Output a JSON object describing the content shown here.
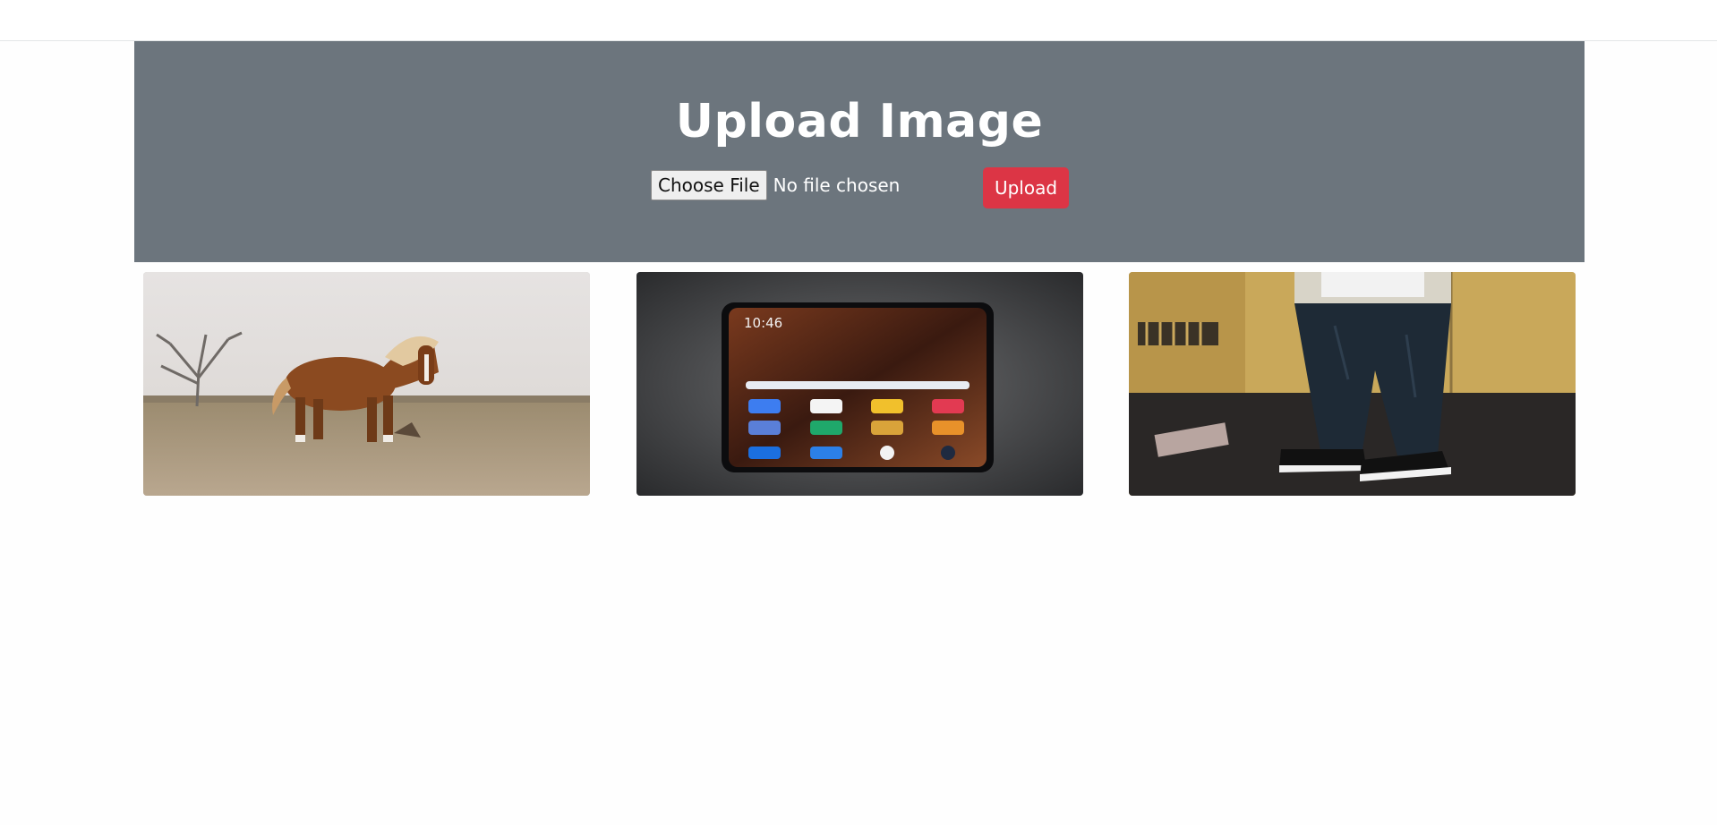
{
  "hero": {
    "title": "Upload Image",
    "choose_file_label": "Choose File",
    "file_status": "No file chosen",
    "upload_label": "Upload",
    "colors": {
      "background": "#6c757d",
      "upload_button": "#dc3545"
    }
  },
  "gallery": {
    "images": [
      {
        "subject": "pony-in-field-photo"
      },
      {
        "subject": "smartphone-homescreen-photo",
        "clock_text": "10:46"
      },
      {
        "subject": "person-in-jeans-and-sneakers-photo"
      }
    ]
  }
}
